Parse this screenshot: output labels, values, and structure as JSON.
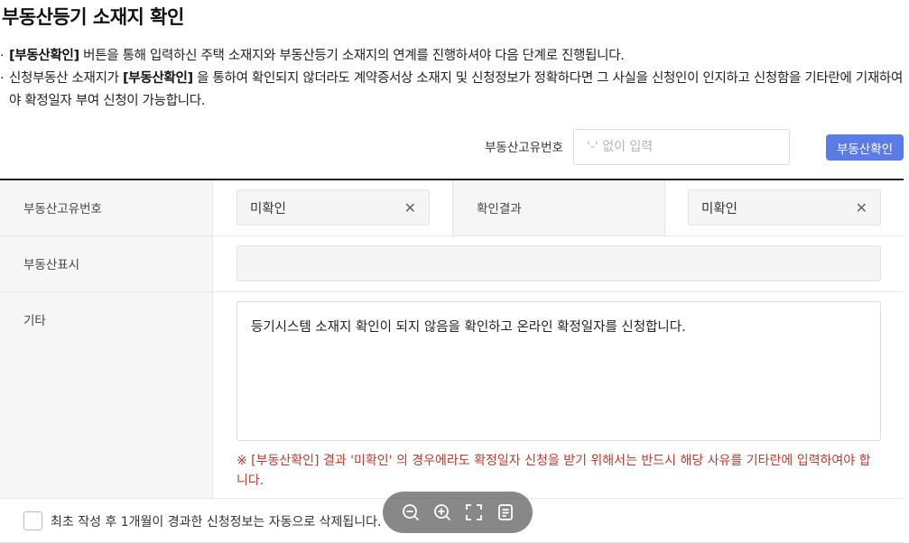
{
  "page": {
    "title": "부동산등기 소재지 확인"
  },
  "notes": {
    "line1_bold": "[부동산확인]",
    "line1_text": " 버튼을 통해 입력하신 주택 소재지와 부동산등기 소재지의 연계를 진행하셔야 다음 단계로 진행됩니다.",
    "line2_text_a": "신청부동산 소재지가 ",
    "line2_bold": "[부동산확인]",
    "line2_text_b": " 을 통하여 확인되지 않더라도 계약증서상 소재지 및 신청정보가 정확하다면 그 사실을 신청인이 인지하고 신청함을 기타란에 기재하여야 확정일자 부여 신청이 가능합니다."
  },
  "search": {
    "label": "부동산고유번호",
    "placeholder": "'-' 없이 입력",
    "button_label": "부동산확인"
  },
  "form": {
    "row1": {
      "label": "부동산고유번호",
      "value": "미확인",
      "result_label": "확인결과",
      "result_value": "미확인"
    },
    "row2": {
      "label": "부동산표시",
      "value": ""
    },
    "row3": {
      "label": "기타",
      "text": "등기시스템 소재지 확인이 되지 않음을 확인하고 온라인 확정일자를 신청합니다.",
      "warning": "※ [부동산확인] 결과 '미확인' 의 경우에라도 확정일자 신청을 받기 위해서는 반드시 해당 사유를 기타란에 입력하여야 합니다."
    }
  },
  "checkbox": {
    "label": "최초 작성 후 1개월이 경과한 신청정보는 자동으로 삭제됩니다."
  },
  "icons": {
    "clear": "close-icon",
    "zoom_out": "zoom-out-icon",
    "zoom_in": "zoom-in-icon",
    "fullscreen": "fullscreen-icon",
    "document": "document-icon"
  },
  "colors": {
    "primary_button": "#5b7be8",
    "warning_text": "#c0392b"
  }
}
